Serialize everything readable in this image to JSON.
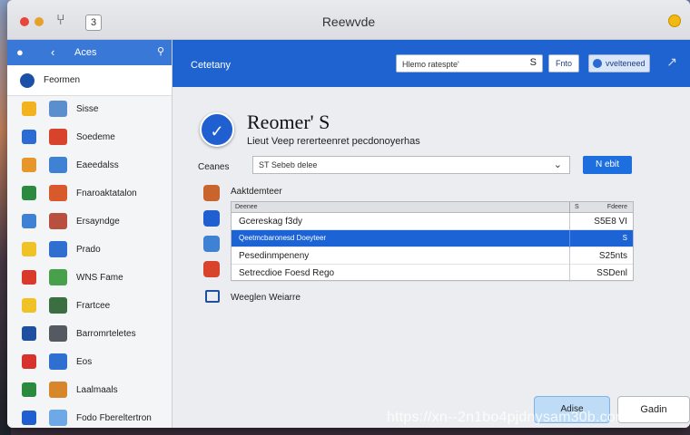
{
  "window": {
    "title": "Reewvde",
    "toolbar_glyph": "⑂",
    "toolbar_box": "3"
  },
  "sidebar": {
    "header_label": "Aces",
    "header_pipe": "‹",
    "selected": {
      "label": "Feormen",
      "icon": "globe-icon"
    },
    "items": [
      {
        "label": "Sisse",
        "icon1": "#f3b321",
        "icon2": "#5b8ecc"
      },
      {
        "label": "Soedeme",
        "icon1": "#2b6bd3",
        "icon2": "#d8432c"
      },
      {
        "label": "Eaeedalss",
        "icon1": "#e6962a",
        "icon2": "#3f82d3"
      },
      {
        "label": "Fnaroaktatalon",
        "icon1": "#2b8a3e",
        "icon2": "#d85a2c"
      },
      {
        "label": "Ersayndge",
        "icon1": "#3f82d3",
        "icon2": "#b94f3e"
      },
      {
        "label": "Prado",
        "icon1": "#f0c226",
        "icon2": "#2f6fd0"
      },
      {
        "label": "WNS Fame",
        "icon1": "#d83a2c",
        "icon2": "#49a04a"
      },
      {
        "label": "Frartcee",
        "icon1": "#f0c226",
        "icon2": "#3b6f42"
      },
      {
        "label": "Barromrteletes",
        "icon1": "#1f4fa0",
        "icon2": "#555a60"
      },
      {
        "label": "Eos",
        "icon1": "#d8322c",
        "icon2": "#2f6fd0"
      },
      {
        "label": "Laalmaals",
        "icon1": "#2b8a3e",
        "icon2": "#d8862c"
      },
      {
        "label": "Fodo Fbereltertron",
        "icon1": "#1f5fd0",
        "icon2": "#6fa8e6"
      }
    ]
  },
  "topbar": {
    "breadcrumb": "Cetetany",
    "search_value": "Hlemo ratespte'",
    "search_suffix": "S",
    "filter_label": "Fnto",
    "user_label": "vvelteneed",
    "arrow": "↗"
  },
  "hero": {
    "title": "Reomer' S",
    "subtitle": "Lieut Veep rererteenret pecdonoyerhas"
  },
  "form": {
    "row_label": "Ceanes",
    "select_value": "ST Sebeb delee",
    "next_label": "N ebit"
  },
  "list": {
    "title": "Aaktdemteer",
    "header": {
      "col1": "Deenee",
      "col2": "S",
      "col3": "Fdeere"
    },
    "rows": [
      {
        "name": "Gcereskag f3dy",
        "value": "S5E8 VI",
        "selected": false
      },
      {
        "name": "Qeetmcbaronesd Doeyteer",
        "value": "S",
        "selected": true
      },
      {
        "name": "Pesedinmpeneny",
        "value": "S25nts",
        "selected": false
      },
      {
        "name": "Setrecdioe Foesd Rego",
        "value": "SSDenl",
        "selected": false
      }
    ],
    "icon_colors": [
      "#c8642c",
      "#1f5fd0",
      "#3f82d3",
      "#d8432c"
    ]
  },
  "footer": {
    "label": "Weeglen Weiarre"
  },
  "buttons": {
    "cancel": "Adise",
    "ok": "Gadin"
  },
  "watermark": "https://xn--2n1bo4pjdnysam30b.com"
}
